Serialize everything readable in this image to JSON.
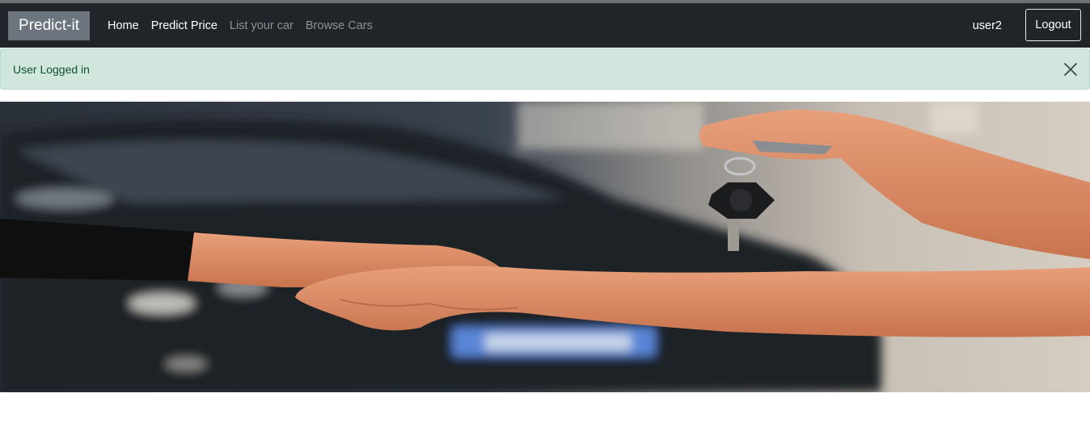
{
  "navbar": {
    "brand": "Predict-it",
    "links": [
      {
        "label": "Home"
      },
      {
        "label": "Predict Price"
      },
      {
        "label": "List your car"
      },
      {
        "label": "Browse Cars"
      }
    ],
    "username": "user2",
    "logout_label": "Logout"
  },
  "alert": {
    "message": "User Logged in",
    "close_icon": "close-icon"
  },
  "hero": {
    "image": "car-keys-handshake-photo"
  },
  "colors": {
    "navbar_bg": "#212529",
    "brand_bg": "#6c757d",
    "alert_bg": "#d1e7dd",
    "alert_text": "#0f5132"
  }
}
